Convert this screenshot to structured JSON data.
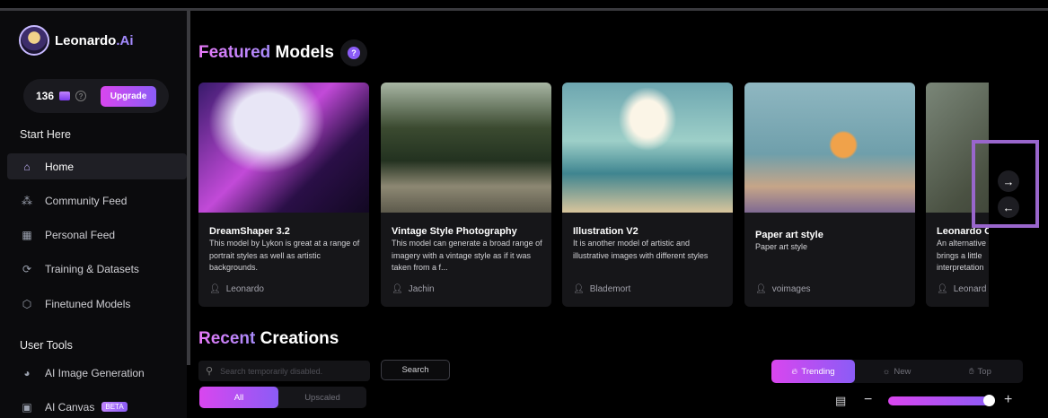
{
  "brand": {
    "name": "Leonardo",
    "suffix": ".Ai"
  },
  "credits": {
    "count": "136",
    "upgrade_label": "Upgrade"
  },
  "sidebar": {
    "section_start": "Start Here",
    "items": [
      {
        "label": "Home",
        "icon": "home-icon",
        "glyph": "⌂"
      },
      {
        "label": "Community Feed",
        "icon": "community-icon",
        "glyph": "⁂"
      },
      {
        "label": "Personal Feed",
        "icon": "grid-icon",
        "glyph": "▦"
      },
      {
        "label": "Training & Datasets",
        "icon": "training-icon",
        "glyph": "⟳"
      },
      {
        "label": "Finetuned Models",
        "icon": "cube-icon",
        "glyph": "⬡"
      }
    ],
    "section_tools": "User Tools",
    "tools": [
      {
        "label": "AI Image Generation",
        "icon": "palette-icon",
        "glyph": "◕"
      },
      {
        "label": "AI Canvas",
        "icon": "canvas-icon",
        "glyph": "▣",
        "badge": "BETA"
      }
    ]
  },
  "featured": {
    "title_accent": "Featured",
    "title_rest": " Models",
    "cards": [
      {
        "title": "DreamShaper 3.2",
        "desc": "This model by Lykon is great at a range of portrait styles as well as artistic backgrounds.",
        "author": "Leonardo"
      },
      {
        "title": "Vintage Style Photography",
        "desc": "This model can generate a broad range of imagery with a vintage style as if it was taken from a f...",
        "author": "Jachin"
      },
      {
        "title": "Illustration V2",
        "desc": "It is another model of artistic and illustrative images with different styles",
        "author": "Blademort"
      },
      {
        "title": "Paper art style",
        "desc": "Paper art style",
        "author": "voimages"
      },
      {
        "title": "Leonardo C",
        "desc": "An alternative brings a little interpretation",
        "author": "Leonard"
      }
    ]
  },
  "recent": {
    "title_accent": "Recent",
    "title_rest": " Creations",
    "search_placeholder": "Search temporarily disabled.",
    "search_button": "Search",
    "filters": [
      "All",
      "Upscaled"
    ],
    "sort": [
      "Trending",
      "New",
      "Top"
    ]
  },
  "colors": {
    "accent_pink": "#d946ef",
    "accent_purple": "#8b5cf6",
    "highlight_frame": "#9966cc"
  }
}
